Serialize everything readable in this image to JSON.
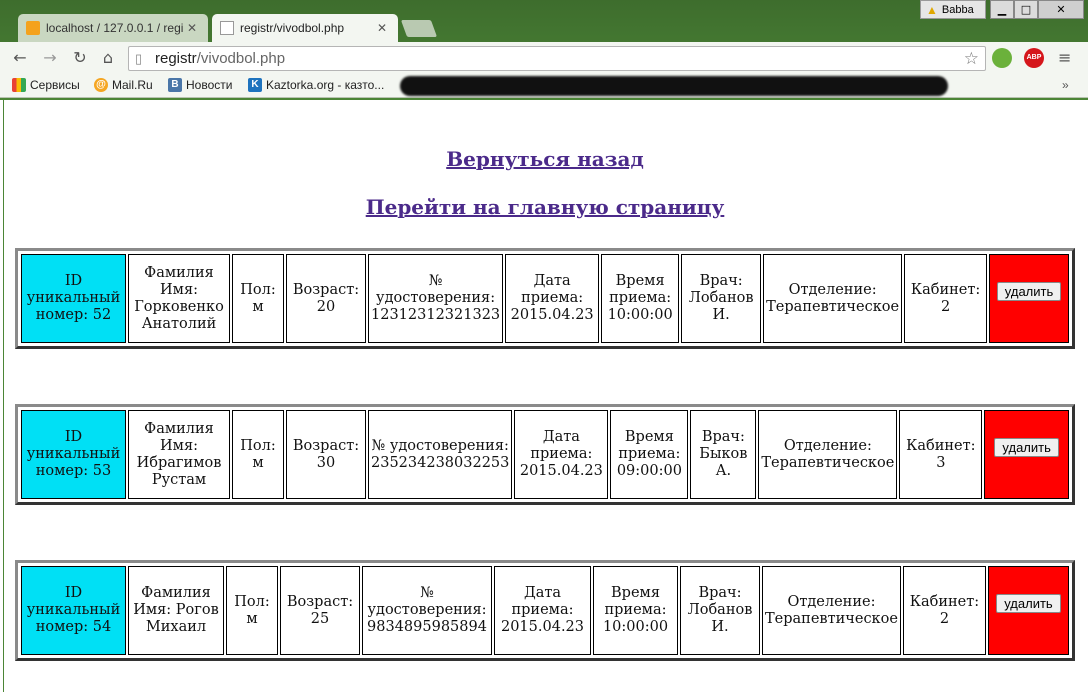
{
  "browser": {
    "tabs": [
      {
        "title": "localhost / 127.0.0.1 / regi"
      },
      {
        "title": "registr/vivodbol.php"
      }
    ],
    "user_name": "Babba",
    "url_host": "registr",
    "url_path": "/vivodbol.php",
    "bookmarks": [
      {
        "label": "Сервисы"
      },
      {
        "label": "Mail.Ru"
      },
      {
        "label": "Новости"
      },
      {
        "label": "Kaztorka.org - казто..."
      }
    ]
  },
  "page": {
    "back_link": "Вернуться назад",
    "home_link": "Перейти на главную страницу",
    "records": [
      {
        "id": "ID уникальный номер: 52",
        "name": "Фамилия Имя: Горковенко Анатолий",
        "sex": "Пол: м",
        "age": "Возраст: 20",
        "cert": "№ удостоверения: 12312312321323",
        "date": "Дата приема: 2015.04.23",
        "time": "Время приема: 10:00:00",
        "doctor": "Врач: Лобанов И.",
        "dept": "Отделение: Терапевтическое",
        "room": "Кабинет: 2",
        "delete_label": "удалить"
      },
      {
        "id": "ID уникальный номер: 53",
        "name": "Фамилия Имя: Ибрагимов Рустам",
        "sex": "Пол: м",
        "age": "Возраст: 30",
        "cert": "№ удостоверения: 235234238032253",
        "date": "Дата приема: 2015.04.23",
        "time": "Время приема: 09:00:00",
        "doctor": "Врач: Быков А.",
        "dept": "Отделение: Терапевтическое",
        "room": "Кабинет: 3",
        "delete_label": "удалить"
      },
      {
        "id": "ID уникальный номер: 54",
        "name": "Фамилия Имя: Рогов Михаил",
        "sex": "Пол: м",
        "age": "Возраст: 25",
        "cert": "№ удостоверения: 9834895985894",
        "date": "Дата приема: 2015.04.23",
        "time": "Время приема: 10:00:00",
        "doctor": "Врач: Лобанов И.",
        "dept": "Отделение: Терапевтическое",
        "room": "Кабинет: 2",
        "delete_label": "удалить"
      }
    ]
  },
  "colors": {
    "id_cell": "#00e0f5",
    "delete_cell": "#ff0000",
    "link": "#4b2a8a",
    "chrome": "#4b8536"
  }
}
